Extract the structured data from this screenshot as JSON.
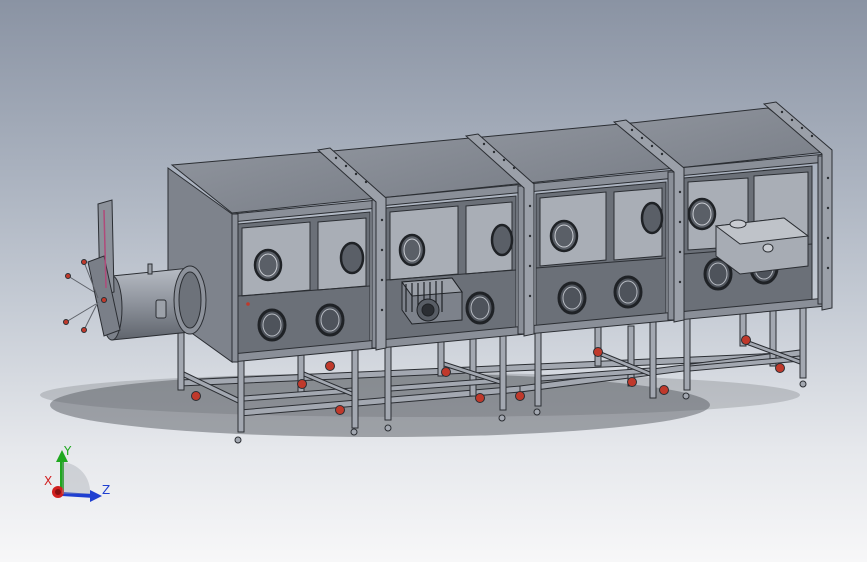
{
  "viewport": {
    "background_top": "#8a93a3",
    "background_bottom": "#f7f7f8"
  },
  "model": {
    "description_icon": "glovebox-assembly-icon",
    "body_color": "#8d929c",
    "body_dark": "#5d626b",
    "frame_color": "#a3a8b1",
    "edge_color": "#2b2e33",
    "wheel_color": "#c0392b"
  },
  "triad": {
    "x_label": "X",
    "y_label": "Y",
    "z_label": "Z",
    "x_color": "#d11f1f",
    "y_color": "#1fa81f",
    "z_color": "#1f3fd1"
  }
}
